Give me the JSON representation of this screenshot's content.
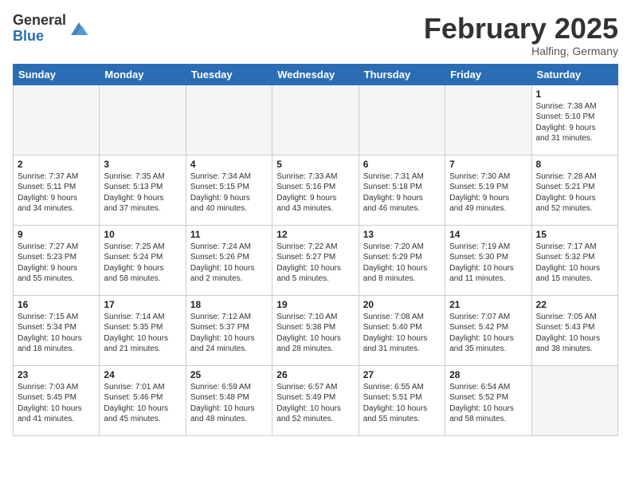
{
  "header": {
    "logo_general": "General",
    "logo_blue": "Blue",
    "title": "February 2025",
    "subtitle": "Halfing, Germany"
  },
  "weekdays": [
    "Sunday",
    "Monday",
    "Tuesday",
    "Wednesday",
    "Thursday",
    "Friday",
    "Saturday"
  ],
  "weeks": [
    [
      {
        "day": "",
        "info": ""
      },
      {
        "day": "",
        "info": ""
      },
      {
        "day": "",
        "info": ""
      },
      {
        "day": "",
        "info": ""
      },
      {
        "day": "",
        "info": ""
      },
      {
        "day": "",
        "info": ""
      },
      {
        "day": "1",
        "info": "Sunrise: 7:38 AM\nSunset: 5:10 PM\nDaylight: 9 hours\nand 31 minutes."
      }
    ],
    [
      {
        "day": "2",
        "info": "Sunrise: 7:37 AM\nSunset: 5:11 PM\nDaylight: 9 hours\nand 34 minutes."
      },
      {
        "day": "3",
        "info": "Sunrise: 7:35 AM\nSunset: 5:13 PM\nDaylight: 9 hours\nand 37 minutes."
      },
      {
        "day": "4",
        "info": "Sunrise: 7:34 AM\nSunset: 5:15 PM\nDaylight: 9 hours\nand 40 minutes."
      },
      {
        "day": "5",
        "info": "Sunrise: 7:33 AM\nSunset: 5:16 PM\nDaylight: 9 hours\nand 43 minutes."
      },
      {
        "day": "6",
        "info": "Sunrise: 7:31 AM\nSunset: 5:18 PM\nDaylight: 9 hours\nand 46 minutes."
      },
      {
        "day": "7",
        "info": "Sunrise: 7:30 AM\nSunset: 5:19 PM\nDaylight: 9 hours\nand 49 minutes."
      },
      {
        "day": "8",
        "info": "Sunrise: 7:28 AM\nSunset: 5:21 PM\nDaylight: 9 hours\nand 52 minutes."
      }
    ],
    [
      {
        "day": "9",
        "info": "Sunrise: 7:27 AM\nSunset: 5:23 PM\nDaylight: 9 hours\nand 55 minutes."
      },
      {
        "day": "10",
        "info": "Sunrise: 7:25 AM\nSunset: 5:24 PM\nDaylight: 9 hours\nand 58 minutes."
      },
      {
        "day": "11",
        "info": "Sunrise: 7:24 AM\nSunset: 5:26 PM\nDaylight: 10 hours\nand 2 minutes."
      },
      {
        "day": "12",
        "info": "Sunrise: 7:22 AM\nSunset: 5:27 PM\nDaylight: 10 hours\nand 5 minutes."
      },
      {
        "day": "13",
        "info": "Sunrise: 7:20 AM\nSunset: 5:29 PM\nDaylight: 10 hours\nand 8 minutes."
      },
      {
        "day": "14",
        "info": "Sunrise: 7:19 AM\nSunset: 5:30 PM\nDaylight: 10 hours\nand 11 minutes."
      },
      {
        "day": "15",
        "info": "Sunrise: 7:17 AM\nSunset: 5:32 PM\nDaylight: 10 hours\nand 15 minutes."
      }
    ],
    [
      {
        "day": "16",
        "info": "Sunrise: 7:15 AM\nSunset: 5:34 PM\nDaylight: 10 hours\nand 18 minutes."
      },
      {
        "day": "17",
        "info": "Sunrise: 7:14 AM\nSunset: 5:35 PM\nDaylight: 10 hours\nand 21 minutes."
      },
      {
        "day": "18",
        "info": "Sunrise: 7:12 AM\nSunset: 5:37 PM\nDaylight: 10 hours\nand 24 minutes."
      },
      {
        "day": "19",
        "info": "Sunrise: 7:10 AM\nSunset: 5:38 PM\nDaylight: 10 hours\nand 28 minutes."
      },
      {
        "day": "20",
        "info": "Sunrise: 7:08 AM\nSunset: 5:40 PM\nDaylight: 10 hours\nand 31 minutes."
      },
      {
        "day": "21",
        "info": "Sunrise: 7:07 AM\nSunset: 5:42 PM\nDaylight: 10 hours\nand 35 minutes."
      },
      {
        "day": "22",
        "info": "Sunrise: 7:05 AM\nSunset: 5:43 PM\nDaylight: 10 hours\nand 38 minutes."
      }
    ],
    [
      {
        "day": "23",
        "info": "Sunrise: 7:03 AM\nSunset: 5:45 PM\nDaylight: 10 hours\nand 41 minutes."
      },
      {
        "day": "24",
        "info": "Sunrise: 7:01 AM\nSunset: 5:46 PM\nDaylight: 10 hours\nand 45 minutes."
      },
      {
        "day": "25",
        "info": "Sunrise: 6:59 AM\nSunset: 5:48 PM\nDaylight: 10 hours\nand 48 minutes."
      },
      {
        "day": "26",
        "info": "Sunrise: 6:57 AM\nSunset: 5:49 PM\nDaylight: 10 hours\nand 52 minutes."
      },
      {
        "day": "27",
        "info": "Sunrise: 6:55 AM\nSunset: 5:51 PM\nDaylight: 10 hours\nand 55 minutes."
      },
      {
        "day": "28",
        "info": "Sunrise: 6:54 AM\nSunset: 5:52 PM\nDaylight: 10 hours\nand 58 minutes."
      },
      {
        "day": "",
        "info": ""
      }
    ]
  ]
}
